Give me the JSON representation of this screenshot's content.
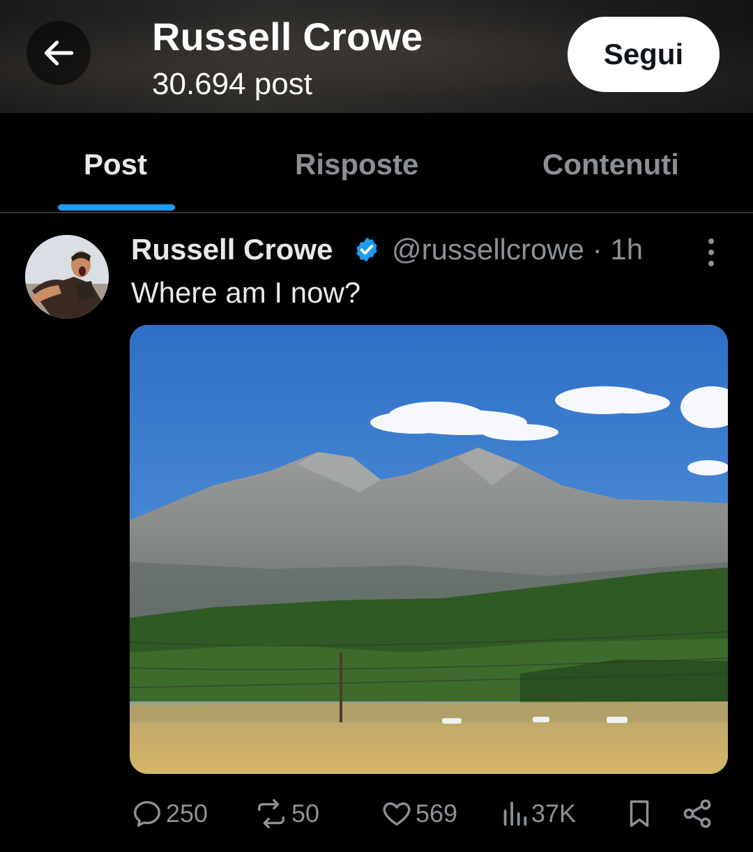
{
  "header": {
    "title": "Russell Crowe",
    "post_count": "30.694 post",
    "follow_label": "Segui"
  },
  "tabs": [
    {
      "label": "Post",
      "active": true
    },
    {
      "label": "Risposte",
      "active": false
    },
    {
      "label": "Contenuti",
      "active": false
    }
  ],
  "tweet": {
    "author": "Russell Crowe",
    "verified": true,
    "handle_time": "@russellcrowe · 1h",
    "text": "Where am I now?",
    "media_icon": "mountain-landscape-photo",
    "stats": {
      "replies": "250",
      "reposts": "50",
      "likes": "569",
      "views": "37K"
    }
  },
  "colors": {
    "accent": "#1d9bf0",
    "background": "#000000",
    "text_primary": "#e7e9ea",
    "text_secondary": "#8b9196"
  }
}
